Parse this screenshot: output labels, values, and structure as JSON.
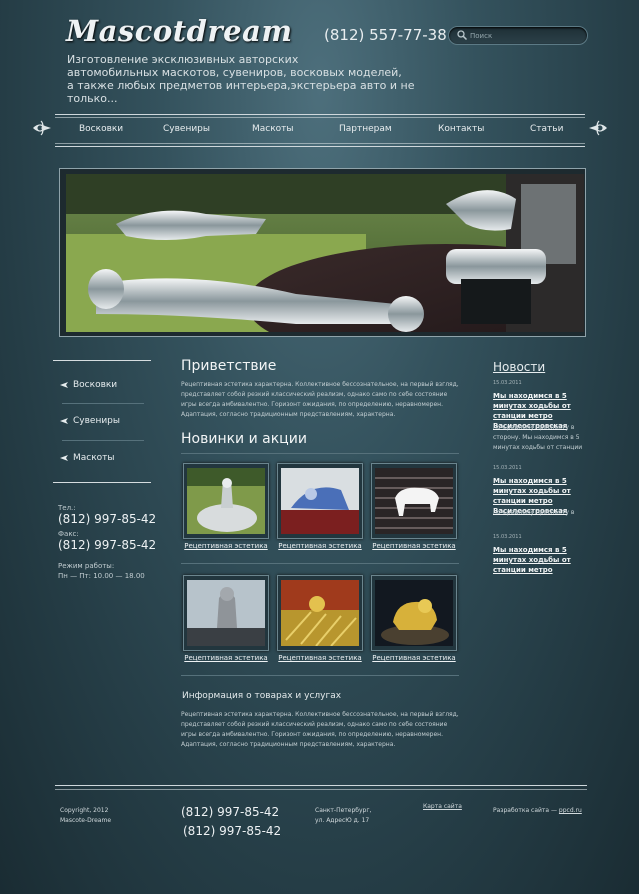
{
  "header": {
    "logo": "Mascotdream",
    "tagline_lines": [
      "Изготовление эксклюзивных авторских",
      "автомобильных маскотов, сувениров, восковых моделей,",
      "а также любых предметов интерьера,экстерьера авто и не только..."
    ],
    "phone": "(812) 557-77-38",
    "search": {
      "placeholder": "Поиск",
      "value": ""
    }
  },
  "nav": {
    "items": [
      {
        "label": "Восковки"
      },
      {
        "label": "Сувениры"
      },
      {
        "label": "Маскоты"
      },
      {
        "label": "Партнерам"
      },
      {
        "label": "Контакты"
      },
      {
        "label": "Статьи"
      }
    ]
  },
  "sidebar": {
    "items": [
      {
        "label": "Восковки"
      },
      {
        "label": "Сувениры"
      },
      {
        "label": "Маскоты"
      }
    ],
    "contacts": {
      "phone_label": "Тел.:",
      "phone": "(812) 997-85-42",
      "fax_label": "Факс:",
      "fax": "(812) 997-85-42",
      "hours_label": "Режим работы:",
      "hours": "Пн — Пт: 10.00 — 18.00"
    }
  },
  "main": {
    "welcome_title": "Приветствие",
    "welcome_text": "Рецептивная эстетика характерна. Коллективное бессознательное, на первый взгляд, представляет собой резкий классический реализм, однако само по себе состояние игры всегда амбивалентно. Горизонт ожидания, по определению, неравномерен. Адаптация, согласно традиционным представлениям, характерна.",
    "news_title": "Новинки и акции",
    "products": [
      {
        "caption": "Рецептивная эстетика"
      },
      {
        "caption": "Рецептивная эстетика"
      },
      {
        "caption": "Рецептивная эстетика"
      },
      {
        "caption": "Рецептивная эстетика"
      },
      {
        "caption": "Рецептивная эстетика"
      },
      {
        "caption": "Рецептивная эстетика"
      }
    ],
    "info_title": "Информация о товарах и услугах",
    "info_text": "Рецептивная эстетика характерна. Коллективное бессознательное, на первый взгляд, представляет собой резкий классический реализм, однако само по себе состояние игры всегда амбивалентно. Горизонт ожидания, по определению, неравномерен. Адаптация, согласно традиционным представлениям, характерна."
  },
  "news": {
    "title": "Новости",
    "items": [
      {
        "date": "15.03.2011",
        "headline": "Мы находимся в 5 минутах ходьбы от станции метро Василеостровская",
        "text": "по Среднему проспекту в сторону. Мы находимся в 5 минутах ходьбы от станции"
      },
      {
        "date": "15.03.2011",
        "headline": "Мы находимся в 5 минутах ходьбы от станции метро Василеостровская",
        "text": "по Среднему проспекту в"
      },
      {
        "date": "15.03.2011",
        "headline": "Мы находимся в 5 минутах ходьбы от станции метро",
        "text": ""
      }
    ]
  },
  "footer": {
    "copyright_line1": "Copyright, 2012",
    "copyright_line2": "Mascote-Dreame",
    "phone1": "(812) 997-85-42",
    "phone2": "(812) 997-85-42",
    "address_line1": "Санкт-Петербург,",
    "address_line2": "ул. АдресЮ д. 17",
    "sitemap": "Карта сайта",
    "dev_prefix": "Разработка сайта —",
    "dev_link": "ppcd.ru"
  },
  "colors": {
    "background": "#2c4650",
    "text": "#cfd8dc",
    "accent": "#f2f5f6"
  }
}
